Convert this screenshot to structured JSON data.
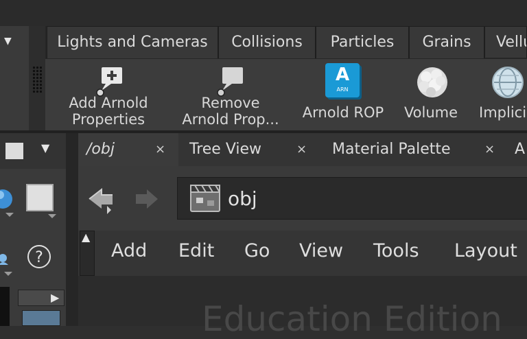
{
  "shelf": {
    "tabs": [
      {
        "label": "Lights and Cameras"
      },
      {
        "label": "Collisions"
      },
      {
        "label": "Particles"
      },
      {
        "label": "Grains"
      },
      {
        "label": "Vellu"
      }
    ],
    "tools": [
      {
        "label_line1": "Add Arnold",
        "label_line2": "Properties",
        "icon": "add-properties-icon"
      },
      {
        "label_line1": "Remove",
        "label_line2": "Arnold Prop...",
        "icon": "remove-properties-icon"
      },
      {
        "label_line1": "Arnold ROP",
        "icon": "arnold-rop-icon",
        "icon_text_big": "A",
        "icon_text_small": "ARN"
      },
      {
        "label_line1": "Volume",
        "icon": "volume-icon"
      },
      {
        "label_line1": "Implici",
        "icon": "implicit-icon"
      }
    ]
  },
  "pane": {
    "tabs": [
      {
        "label": "/obj",
        "close": "×"
      },
      {
        "label": "Tree View",
        "close": "×"
      },
      {
        "label": "Material Palette",
        "close": "×"
      },
      {
        "label": "A"
      }
    ],
    "path": "obj",
    "menu": [
      "Add",
      "Edit",
      "Go",
      "View",
      "Tools",
      "Layout"
    ],
    "watermark": "Education Edition"
  },
  "colors": {
    "accent_blue": "#1a9ad6",
    "panel": "#3a3a3a",
    "dark": "#2a2a2a"
  }
}
